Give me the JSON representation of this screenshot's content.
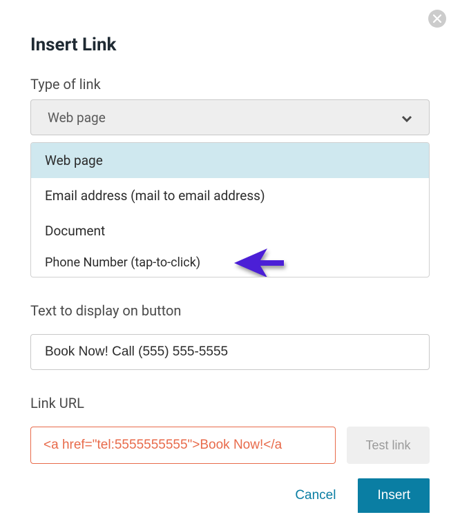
{
  "dialog": {
    "title": "Insert Link"
  },
  "type_of_link": {
    "label": "Type of link",
    "selected": "Web page",
    "options": [
      "Web page",
      "Email address (mail to email address)",
      "Document",
      "Phone Number (tap-to-click)"
    ]
  },
  "text_display": {
    "label": "Text to display on button",
    "value": "Book Now! Call (555) 555-5555"
  },
  "link_url": {
    "label": "Link URL",
    "value": "<a href=\"tel:5555555555\">Book Now!</a",
    "test_label": "Test link"
  },
  "footer": {
    "cancel": "Cancel",
    "insert": "Insert"
  }
}
